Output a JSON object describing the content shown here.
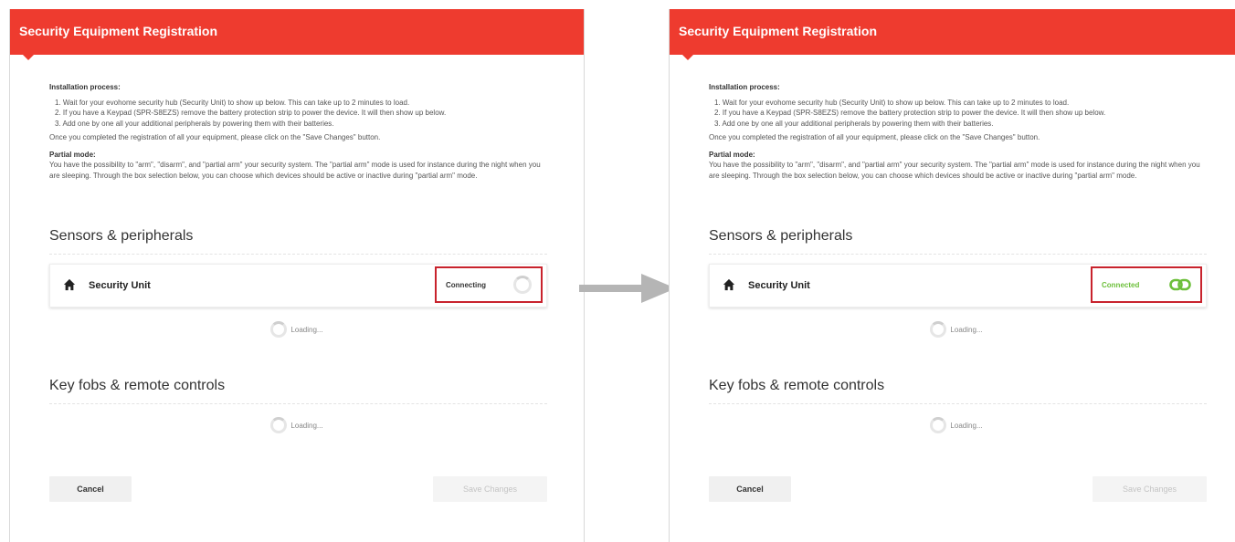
{
  "panels": [
    {
      "title": "Security Equipment Registration",
      "installation_label": "Installation process:",
      "steps": [
        "1. Wait for your evohome security hub (Security Unit) to show up below. This can take up to 2 minutes to load.",
        "2. If you have a Keypad (SPR-S8EZS) remove the battery protection strip to power the device. It will then show up below.",
        "3. Add one by one all your additional peripherals by powering them with their batteries."
      ],
      "once_text": "Once you completed the registration of all your equipment, please click on the \"Save Changes\" button.",
      "partial_label": "Partial mode:",
      "partial_text": "You have the possibility to \"arm\", \"disarm\", and \"partial arm\" your security system. The \"partial arm\" mode is used for instance during the night when you are sleeping. Through the box selection below, you can choose which devices should be active or inactive during \"partial arm\" mode.",
      "sensors_title": "Sensors & peripherals",
      "device_name": "Security Unit",
      "device_icon": "home-icon",
      "status": "Connecting",
      "status_icon": "spinner-icon",
      "loading_1": "Loading...",
      "keyfobs_title": "Key fobs & remote controls",
      "loading_2": "Loading...",
      "cancel_label": "Cancel",
      "save_label": "Save Changes"
    },
    {
      "title": "Security Equipment Registration",
      "installation_label": "Installation process:",
      "steps": [
        "1. Wait for your evohome security hub (Security Unit) to show up below. This can take up to 2 minutes to load.",
        "2. If you have a Keypad (SPR-S8EZS) remove the battery protection strip to power the device. It will then show up below.",
        "3. Add one by one all your additional peripherals by powering them with their batteries."
      ],
      "once_text": "Once you completed the registration of all your equipment, please click on the \"Save Changes\" button.",
      "partial_label": "Partial mode:",
      "partial_text": "You have the possibility to \"arm\", \"disarm\", and \"partial arm\" your security system. The \"partial arm\" mode is used for instance during the night when you are sleeping. Through the box selection below, you can choose which devices should be active or inactive during \"partial arm\" mode.",
      "sensors_title": "Sensors & peripherals",
      "device_name": "Security Unit",
      "device_icon": "home-icon",
      "status": "Connected",
      "status_icon": "link-icon",
      "loading_1": "Loading...",
      "keyfobs_title": "Key fobs & remote controls",
      "loading_2": "Loading...",
      "cancel_label": "Cancel",
      "save_label": "Save Changes"
    }
  ],
  "colors": {
    "header": "#ee3b2f",
    "highlight_box": "#c8222c",
    "connected": "#6cbf3a",
    "arrow": "#b5b5b5"
  }
}
